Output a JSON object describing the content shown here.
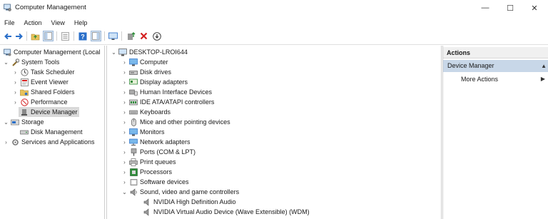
{
  "window": {
    "title": "Computer Management",
    "minimize_glyph": "—",
    "maximize_glyph": "☐",
    "close_glyph": "✕"
  },
  "menu": [
    "File",
    "Action",
    "View",
    "Help"
  ],
  "toolbar": {
    "icons": [
      "back-arrow-icon",
      "forward-arrow-icon",
      "up-folder-icon",
      "show-hide-tree-icon",
      "properties-icon",
      "help-icon",
      "show-hide-action-pane-icon",
      "monitor-icon",
      "update-driver-icon",
      "uninstall-icon",
      "download-icon"
    ]
  },
  "left_tree": {
    "items": [
      {
        "label": "Computer Management (Local",
        "icon": "computer-management-icon",
        "chevron": ""
      },
      {
        "label": "System Tools",
        "icon": "tools-icon",
        "chevron": "⌄"
      },
      {
        "label": "Task Scheduler",
        "icon": "clock-icon",
        "chevron": "›"
      },
      {
        "label": "Event Viewer",
        "icon": "event-viewer-icon",
        "chevron": "›"
      },
      {
        "label": "Shared Folders",
        "icon": "shared-folder-icon",
        "chevron": "›"
      },
      {
        "label": "Performance",
        "icon": "performance-icon",
        "chevron": "›"
      },
      {
        "label": "Device Manager",
        "icon": "device-manager-icon",
        "chevron": ""
      },
      {
        "label": "Storage",
        "icon": "storage-icon",
        "chevron": "⌄"
      },
      {
        "label": "Disk Management",
        "icon": "disk-icon",
        "chevron": ""
      },
      {
        "label": "Services and Applications",
        "icon": "services-icon",
        "chevron": "›"
      }
    ]
  },
  "device_tree": {
    "root": "DESKTOP-LROI644",
    "items": [
      {
        "label": "Computer",
        "icon": "computer-icon",
        "chevron": "›"
      },
      {
        "label": "Disk drives",
        "icon": "disk-drive-icon",
        "chevron": "›"
      },
      {
        "label": "Display adapters",
        "icon": "display-adapter-icon",
        "chevron": "›"
      },
      {
        "label": "Human Interface Devices",
        "icon": "hid-icon",
        "chevron": "›"
      },
      {
        "label": "IDE ATA/ATAPI controllers",
        "icon": "ide-controller-icon",
        "chevron": "›"
      },
      {
        "label": "Keyboards",
        "icon": "keyboard-icon",
        "chevron": "›"
      },
      {
        "label": "Mice and other pointing devices",
        "icon": "mouse-icon",
        "chevron": "›"
      },
      {
        "label": "Monitors",
        "icon": "monitor-icon",
        "chevron": "›"
      },
      {
        "label": "Network adapters",
        "icon": "network-adapter-icon",
        "chevron": "›"
      },
      {
        "label": "Ports (COM & LPT)",
        "icon": "port-icon",
        "chevron": "›"
      },
      {
        "label": "Print queues",
        "icon": "printer-icon",
        "chevron": "›"
      },
      {
        "label": "Processors",
        "icon": "processor-icon",
        "chevron": "›"
      },
      {
        "label": "Software devices",
        "icon": "software-device-icon",
        "chevron": "›"
      },
      {
        "label": "Sound, video and game controllers",
        "icon": "sound-icon",
        "chevron": "⌄"
      },
      {
        "label": "NVIDIA High Definition Audio",
        "icon": "speaker-icon",
        "chevron": ""
      },
      {
        "label": "NVIDIA Virtual Audio Device (Wave Extensible) (WDM)",
        "icon": "speaker-icon",
        "chevron": ""
      }
    ]
  },
  "actions": {
    "header": "Actions",
    "section": "Device Manager",
    "section_glyph": "▲",
    "more": "More Actions",
    "more_glyph": "▶"
  },
  "colors": {
    "selection": "#d9d9d9",
    "actions_section_bg": "#c8d7e8",
    "toolbar_blue": "#2a6fc9",
    "uninstall_red": "#d42020",
    "update_green": "#2e8b3a"
  }
}
